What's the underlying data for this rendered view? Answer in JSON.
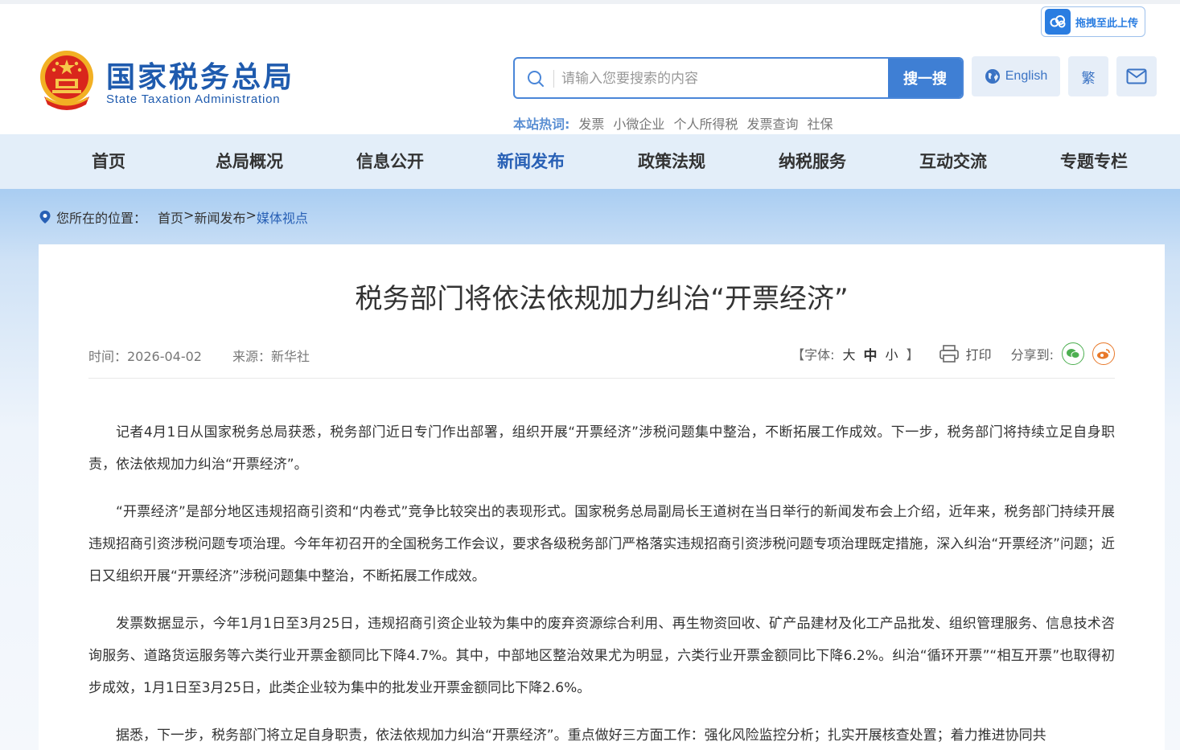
{
  "header": {
    "logo_cn": "国家税务总局",
    "logo_en": "State Taxation Administration",
    "search_placeholder": "请输入您要搜索的内容",
    "search_button": "搜一搜",
    "english_label": "English",
    "traditional_label": "繁",
    "upload_label": "拖拽至此上传",
    "hotwords_label": "本站热词:",
    "hotwords": [
      "发票",
      "小微企业",
      "个人所得税",
      "发票查询",
      "社保"
    ]
  },
  "nav": {
    "items": [
      "首页",
      "总局概况",
      "信息公开",
      "新闻发布",
      "政策法规",
      "纳税服务",
      "互动交流",
      "专题专栏"
    ],
    "active": "新闻发布"
  },
  "breadcrumb": {
    "label": "您所在的位置：",
    "home": "首页",
    "sep": ">",
    "section": "新闻发布",
    "current": "媒体视点"
  },
  "article": {
    "title": "税务部门将依法依规加力纠治“开票经济”",
    "time": "时间：2026-04-02",
    "source": "来源：新华社",
    "font_open": "【字体:",
    "font_large": "大",
    "font_medium": "中",
    "font_small": "小",
    "font_close": "】",
    "print": "打印",
    "share": "分享到:",
    "paragraphs": [
      "记者4月1日从国家税务总局获悉，税务部门近日专门作出部署，组织开展“开票经济”涉税问题集中整治，不断拓展工作成效。下一步，税务部门将持续立足自身职责，依法依规加力纠治“开票经济”。",
      "“开票经济”是部分地区违规招商引资和“内卷式”竞争比较突出的表现形式。国家税务总局副局长王道树在当日举行的新闻发布会上介绍，近年来，税务部门持续开展违规招商引资涉税问题专项治理。今年年初召开的全国税务工作会议，要求各级税务部门严格落实违规招商引资涉税问题专项治理既定措施，深入纠治“开票经济”问题；近日又组织开展“开票经济”涉税问题集中整治，不断拓展工作成效。",
      "发票数据显示，今年1月1日至3月25日，违规招商引资企业较为集中的废弃资源综合利用、再生物资回收、矿产品建材及化工产品批发、组织管理服务、信息技术咨询服务、道路货运服务等六类行业开票金额同比下降4.7%。其中，中部地区整治效果尤为明显，六类行业开票金额同比下降6.2%。纠治“循环开票”“相互开票”也取得初步成效，1月1日至3月25日，此类企业较为集中的批发业开票金额同比下降2.6%。",
      "据悉，下一步，税务部门将立足自身职责，依法依规加力纠治“开票经济”。重点做好三方面工作：强化风险监控分析；扎实开展核查处置；着力推进协同共"
    ]
  },
  "colors": {
    "brand_blue": "#1f5bae",
    "nav_bg": "#e3eef9",
    "search_button": "#3f7fd4",
    "wechat_green": "#4caf50",
    "weibo_orange": "#e8782a"
  }
}
